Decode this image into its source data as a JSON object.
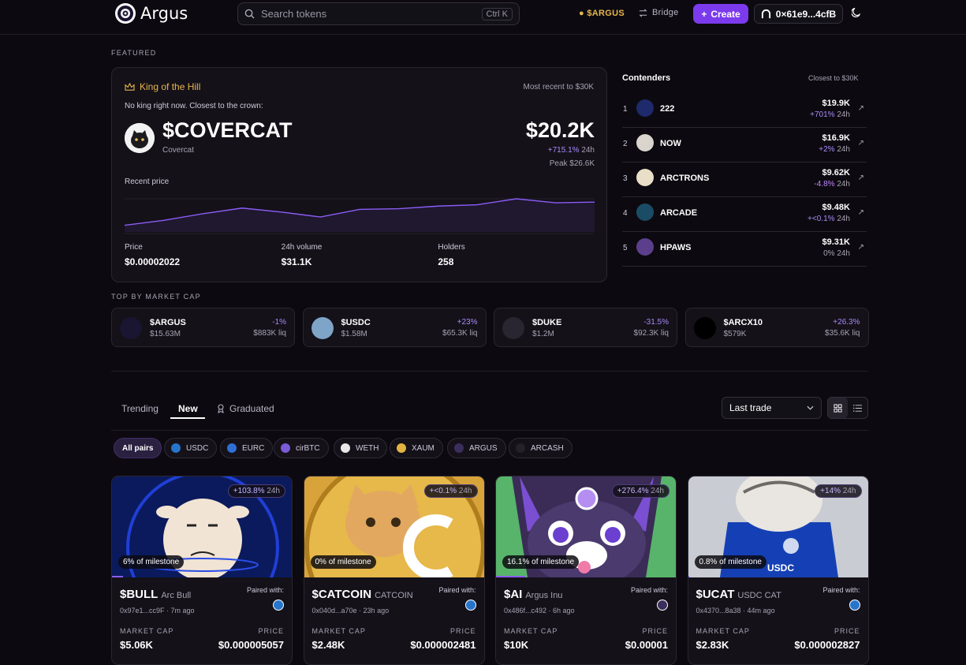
{
  "header": {
    "app_name": "Argus",
    "search_placeholder": "Search tokens",
    "search_shortcut": "Ctrl K",
    "token_link": "$ARGUS",
    "bridge_label": "Bridge",
    "create_label": "Create",
    "wallet_label": "0×61e9...4cfB"
  },
  "featured": {
    "section_label": "FEATURED",
    "king": {
      "title": "King of the Hill",
      "right_label": "Most recent to $30K",
      "subtitle": "No king right now. Closest to the crown:",
      "ticker": "$COVERCAT",
      "name": "Covercat",
      "market_cap": "$20.2K",
      "change": "+715.1%",
      "change_period": "24h",
      "peak": "Peak $26.6K",
      "recent_price_label": "Recent price",
      "price_series": [
        0.2,
        0.35,
        0.55,
        0.72,
        0.6,
        0.45,
        0.68,
        0.7,
        0.78,
        0.82,
        1.0,
        0.88,
        0.9
      ],
      "stats": [
        {
          "label": "Price",
          "value": "$0.00002022"
        },
        {
          "label": "24h volume",
          "value": "$31.1K"
        },
        {
          "label": "Holders",
          "value": "258"
        }
      ]
    },
    "contenders": {
      "title": "Contenders",
      "right_label": "Closest to $30K",
      "items": [
        {
          "rank": "1",
          "name": "222",
          "cap": "$19.9K",
          "change": "+701%",
          "period": "24h",
          "dir": "up",
          "icon": "222-avatar",
          "color": "#1e2a6b"
        },
        {
          "rank": "2",
          "name": "NOW",
          "cap": "$16.9K",
          "change": "+2%",
          "period": "24h",
          "dir": "up",
          "icon": "now-avatar",
          "color": "#d9d4cc"
        },
        {
          "rank": "3",
          "name": "ARCTRONS",
          "cap": "$9.62K",
          "change": "-4.8%",
          "period": "24h",
          "dir": "neg",
          "icon": "arctrons-avatar",
          "color": "#e9dfc8"
        },
        {
          "rank": "4",
          "name": "ARCADE",
          "cap": "$9.48K",
          "change": "+<0.1%",
          "period": "24h",
          "dir": "up",
          "icon": "arcade-avatar",
          "color": "#1b4c66"
        },
        {
          "rank": "5",
          "name": "HPAWS",
          "cap": "$9.31K",
          "change": "0%",
          "period": "24h",
          "dir": "zero",
          "icon": "hpaws-avatar",
          "color": "#5b3f8c"
        }
      ]
    }
  },
  "top_market_cap": {
    "section_label": "TOP BY MARKET CAP",
    "items": [
      {
        "ticker": "$ARGUS",
        "cap": "$15.63M",
        "change": "-1%",
        "liq": "$883K liq",
        "icon": "argus-icon",
        "color": "#1a1530"
      },
      {
        "ticker": "$USDC",
        "cap": "$1.58M",
        "change": "+23%",
        "liq": "$65.3K liq",
        "icon": "usdc-cat-icon",
        "color": "#7ea4c8"
      },
      {
        "ticker": "$DUKE",
        "cap": "$1.2M",
        "change": "-31.5%",
        "liq": "$92.3K liq",
        "icon": "duke-icon",
        "color": "#2a2631"
      },
      {
        "ticker": "$ARCX10",
        "cap": "$579K",
        "change": "+26.3%",
        "liq": "$35.6K liq",
        "icon": "arcx10-icon",
        "color": "#000000"
      }
    ]
  },
  "listing": {
    "tabs": [
      {
        "label": "Trending",
        "active": false
      },
      {
        "label": "New",
        "active": true
      },
      {
        "label": "Graduated",
        "active": false
      }
    ],
    "sort_value": "Last trade",
    "pairs": [
      {
        "label": "All pairs",
        "color": ""
      },
      {
        "label": "USDC",
        "color": "#2775ca"
      },
      {
        "label": "EURC",
        "color": "#2f6fd4"
      },
      {
        "label": "cirBTC",
        "color": "#7b5cd6"
      },
      {
        "label": "WETH",
        "color": "#e8e8e8"
      },
      {
        "label": "XAUM",
        "color": "#e3b341"
      },
      {
        "label": "ARGUS",
        "color": "#3a2f5c"
      },
      {
        "label": "ARCASH",
        "color": "#24212b"
      }
    ],
    "tokens": [
      {
        "ticker": "$BULL",
        "name": "Arc Bull",
        "address": "0x97e1...cc9F · 7m ago",
        "change": "+103.8%",
        "period": "24h",
        "milestone": "6% of milestone",
        "milestone_frac": 0.06,
        "paired_label": "Paired with:",
        "pair_icon": "usdc-icon",
        "mc_label": "MARKET CAP",
        "price_label": "PRICE",
        "market_cap": "$5.06K",
        "price": "$0.000005057"
      },
      {
        "ticker": "$CATCOIN",
        "name": "CATCOIN",
        "address": "0x040d...a70e · 23h ago",
        "change": "+<0.1%",
        "period": "24h",
        "milestone": "0% of milestone",
        "milestone_frac": 0.0,
        "paired_label": "Paired with:",
        "pair_icon": "usdc-icon",
        "mc_label": "MARKET CAP",
        "price_label": "PRICE",
        "market_cap": "$2.48K",
        "price": "$0.000002481"
      },
      {
        "ticker": "$AI",
        "name": "Argus Inu",
        "address": "0x486f...c492 · 6h ago",
        "change": "+276.4%",
        "period": "24h",
        "milestone": "16.1% of milestone",
        "milestone_frac": 0.161,
        "paired_label": "Paired with:",
        "pair_icon": "argus-icon",
        "mc_label": "MARKET CAP",
        "price_label": "PRICE",
        "market_cap": "$10K",
        "price": "$0.00001"
      },
      {
        "ticker": "$UCAT",
        "name": "USDC CAT",
        "address": "0x4370...8a38 · 44m ago",
        "change": "+14%",
        "period": "24h",
        "milestone": "0.8% of milestone",
        "milestone_frac": 0.008,
        "paired_label": "Paired with:",
        "pair_icon": "usdc-icon",
        "mc_label": "MARKET CAP",
        "price_label": "PRICE",
        "market_cap": "$2.83K",
        "price": "$0.000002827"
      }
    ]
  },
  "colors": {
    "accent": "#7c3aed",
    "gold": "#e8b64c",
    "positive": "#a78bfa",
    "background": "#0c0a10"
  }
}
